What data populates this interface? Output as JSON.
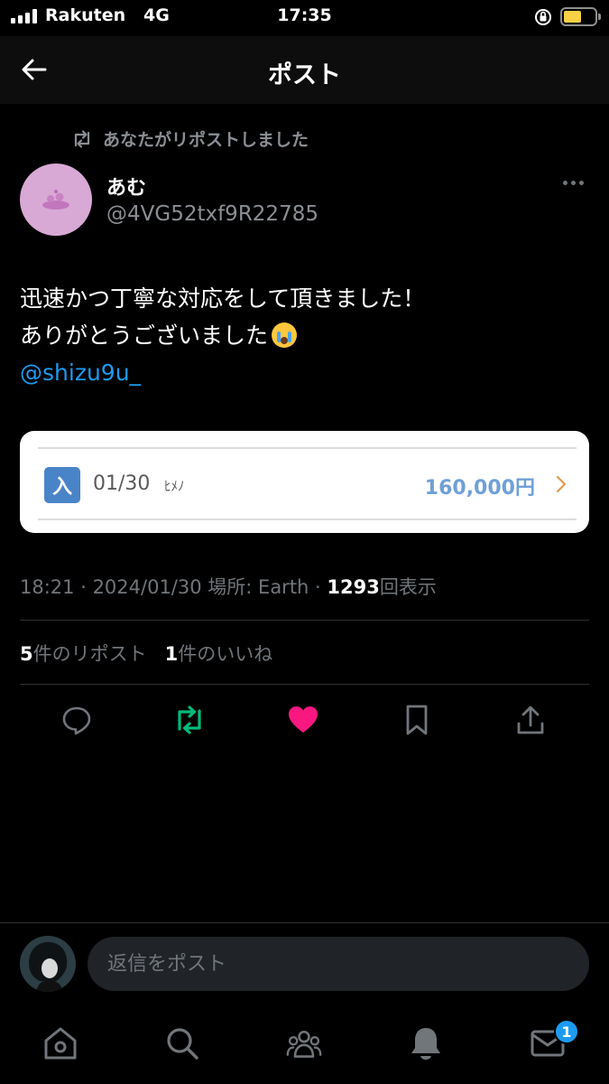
{
  "status_bar": {
    "carrier": "Rakuten",
    "network": "4G",
    "time": "17:35",
    "battery_level": 0.45,
    "battery_color": "#f7d046"
  },
  "header": {
    "title": "ポスト",
    "back_icon": "arrow-left-icon"
  },
  "repost_context": {
    "text": "あなたがリポストしました",
    "icon": "repost-icon"
  },
  "author": {
    "name": "あむ",
    "handle": "@4VG52txf9R22785"
  },
  "tweet": {
    "line1": "迅速かつ丁寧な対応をして頂きました！",
    "line2": "ありがとうございました",
    "emoji": "loudly-crying-face",
    "mention": "@shizu9u_"
  },
  "card": {
    "badge": "入",
    "date": "01/30",
    "desc": "ﾋﾒﾉ",
    "amount": "160,000円",
    "accent": "#4a84c8"
  },
  "meta": {
    "time": "18:21",
    "date": "2024/01/30",
    "location": "場所: Earth",
    "views_count": "1293",
    "views_label": "回表示"
  },
  "stats": {
    "reposts_count": "5",
    "reposts_label": "件のリポスト",
    "likes_count": "1",
    "likes_label": "件のいいね"
  },
  "actions": [
    {
      "name": "reply",
      "icon": "comment-icon",
      "color": "#71767b"
    },
    {
      "name": "repost",
      "icon": "repost-icon",
      "color": "#00ba7c"
    },
    {
      "name": "like",
      "icon": "heart-icon",
      "color": "#f91880"
    },
    {
      "name": "bookmark",
      "icon": "bookmark-icon",
      "color": "#71767b"
    },
    {
      "name": "share",
      "icon": "share-icon",
      "color": "#71767b"
    }
  ],
  "reply": {
    "placeholder": "返信をポスト"
  },
  "tabbar": {
    "tabs": [
      "home-icon",
      "search-icon",
      "communities-icon",
      "notifications-icon",
      "messages-icon"
    ],
    "messages_badge": "1"
  }
}
